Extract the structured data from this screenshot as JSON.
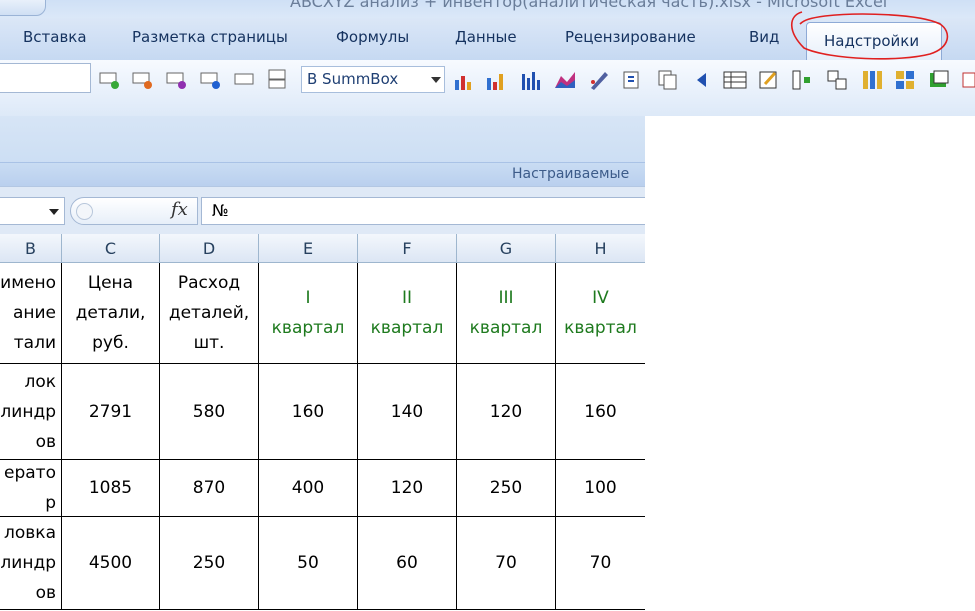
{
  "window": {
    "title": "ABCXYZ анализ + инвентор(аналитическая часть).xlsx - Microsoft Excel"
  },
  "ribbon": {
    "tabs": [
      {
        "label": "Вставка"
      },
      {
        "label": "Разметка страницы"
      },
      {
        "label": "Формулы"
      },
      {
        "label": "Данные"
      },
      {
        "label": "Рецензирование"
      },
      {
        "label": "Вид"
      }
    ],
    "active_tab": "Надстройки",
    "toolbar_dropdown_value": "B SummBox",
    "group_label": "Настраиваемые",
    "annotation_color": "#e02020",
    "icons": [
      "add-cell-icon",
      "delete-cell-icon",
      "purple-cell-icon",
      "blue-cell-icon",
      "blank-box-icon",
      "number-format-icon",
      "abc-chart-icon",
      "xyz-chart-icon",
      "bar-chart-icon",
      "area-chart-icon",
      "pen-chart-icon",
      "formula-icon",
      "copy-icon",
      "arrow-left-icon",
      "table-icon",
      "edit-icon",
      "split-icon",
      "link-icon",
      "columns-icon",
      "grid-icon",
      "export-icon"
    ]
  },
  "formula_bar": {
    "name_box": "",
    "fx_label": "fx",
    "content": "№"
  },
  "sheet": {
    "columns": [
      "B",
      "C",
      "D",
      "E",
      "F",
      "G",
      "H"
    ],
    "header_row": [
      "имено\nание\nтали",
      "Цена\nдетали,\nруб.",
      "Расход\nдеталей,\nшт.",
      "I\nквартал",
      "II\nквартал",
      "III\nквартал",
      "IV\nквартал"
    ],
    "rows": [
      [
        "лок\nилиндр\nов",
        "2791",
        "580",
        "160",
        "140",
        "120",
        "160"
      ],
      [
        "ерато\nр",
        "1085",
        "870",
        "400",
        "120",
        "250",
        "100"
      ],
      [
        "ловка\nилиндр\nов",
        "4500",
        "250",
        "50",
        "60",
        "70",
        "70"
      ]
    ],
    "quarter_text_color": "#1e7a1e"
  }
}
